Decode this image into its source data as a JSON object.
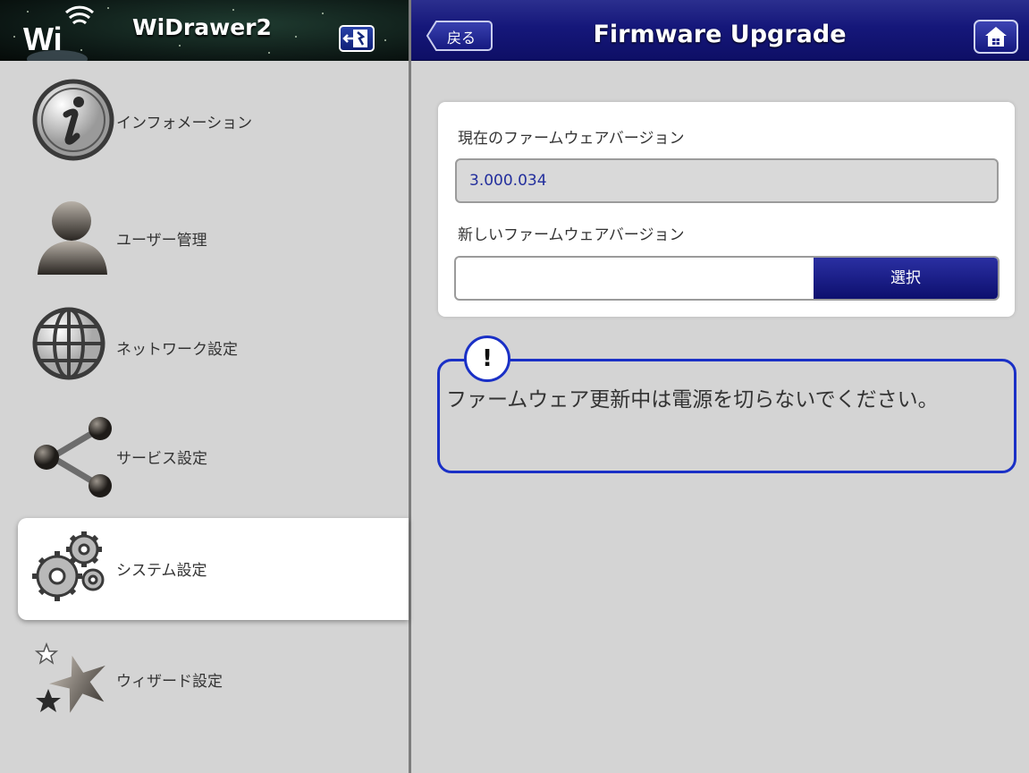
{
  "app": {
    "name": "WiDrawer2",
    "logo_text": "Wi"
  },
  "header": {
    "back_label": "戻る",
    "title": "Firmware Upgrade"
  },
  "sidebar": {
    "items": [
      {
        "label": "インフォメーション",
        "icon": "info-icon"
      },
      {
        "label": "ユーザー管理",
        "icon": "user-icon"
      },
      {
        "label": "ネットワーク設定",
        "icon": "globe-icon"
      },
      {
        "label": "サービス設定",
        "icon": "share-icon"
      },
      {
        "label": "システム設定",
        "icon": "gears-icon",
        "active": true
      },
      {
        "label": "ウィザード設定",
        "icon": "stars-icon"
      }
    ]
  },
  "firmware": {
    "current_label": "現在のファームウェアバージョン",
    "current_value": "3.000.034",
    "new_label": "新しいファームウェアバージョン",
    "new_value": "",
    "select_label": "選択"
  },
  "warning": {
    "badge": "!",
    "text": "ファームウェア更新中は電源を切らないでください。"
  },
  "colors": {
    "header_blue": "#15177a",
    "accent_border": "#1a30c6",
    "sidebar_bg": "#d4d4d4"
  }
}
